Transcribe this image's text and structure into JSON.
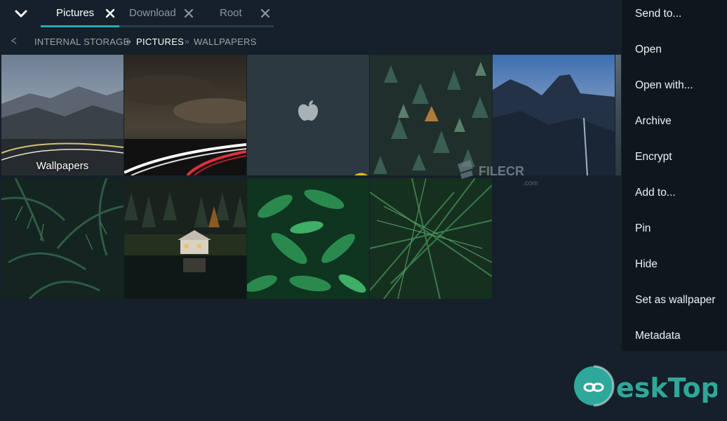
{
  "tabs": [
    {
      "label": "Pictures",
      "active": true
    },
    {
      "label": "Download",
      "active": false
    },
    {
      "label": "Root",
      "active": false
    }
  ],
  "breadcrumb": [
    "INTERNAL STORAGE",
    "PICTURES",
    "WALLPAPERS"
  ],
  "breadcrumb_separator": "»",
  "tiles": [
    {
      "name": "mountains-road",
      "label": "Wallpapers"
    },
    {
      "name": "highway-lights"
    },
    {
      "name": "apple-logo-dark",
      "selected": true
    },
    {
      "name": "forest-aerial"
    },
    {
      "name": "mountain-dusk"
    },
    {
      "name": "palm-leaves"
    },
    {
      "name": "lake-house"
    },
    {
      "name": "green-leaves"
    },
    {
      "name": "grass-blades"
    }
  ],
  "menu": [
    "Send to...",
    "Open",
    "Open with...",
    "Archive",
    "Encrypt",
    "Add to...",
    "Pin",
    "Hide",
    "Set as wallpaper",
    "Metadata"
  ],
  "watermarks": {
    "filecr": {
      "text": "FILECR",
      "sub": ".com"
    },
    "desktop": {
      "text": "eskTop"
    }
  },
  "colors": {
    "accent": "#2fa6b0",
    "background": "#15202a",
    "menu_bg": "#0f171e",
    "check": "#f2b61c"
  },
  "icons": {
    "collapse": "chevron-down-icon",
    "tab_close": "close-icon",
    "breadcrumb_back": "back-arrow-icon",
    "selected": "checkmark-icon"
  }
}
